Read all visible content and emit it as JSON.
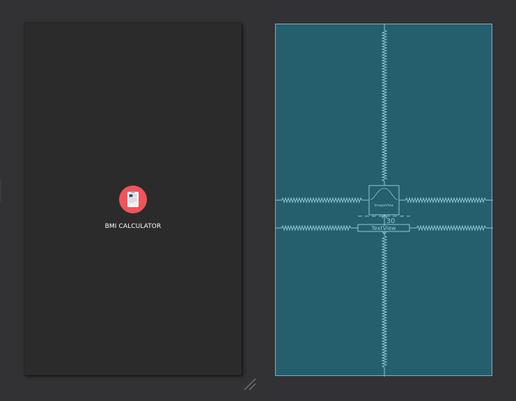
{
  "design_preview": {
    "app_title": "BMI CALCULATOR",
    "logo_icon": "clipboard-icon",
    "background_color": "#2b2b2b",
    "logo_color": "#f0545a"
  },
  "blueprint": {
    "background_color": "#255e6d",
    "line_color": "#8ec9d6",
    "imageview_label": "ImageView",
    "textview_label": "TextView",
    "margin_value": "30"
  }
}
